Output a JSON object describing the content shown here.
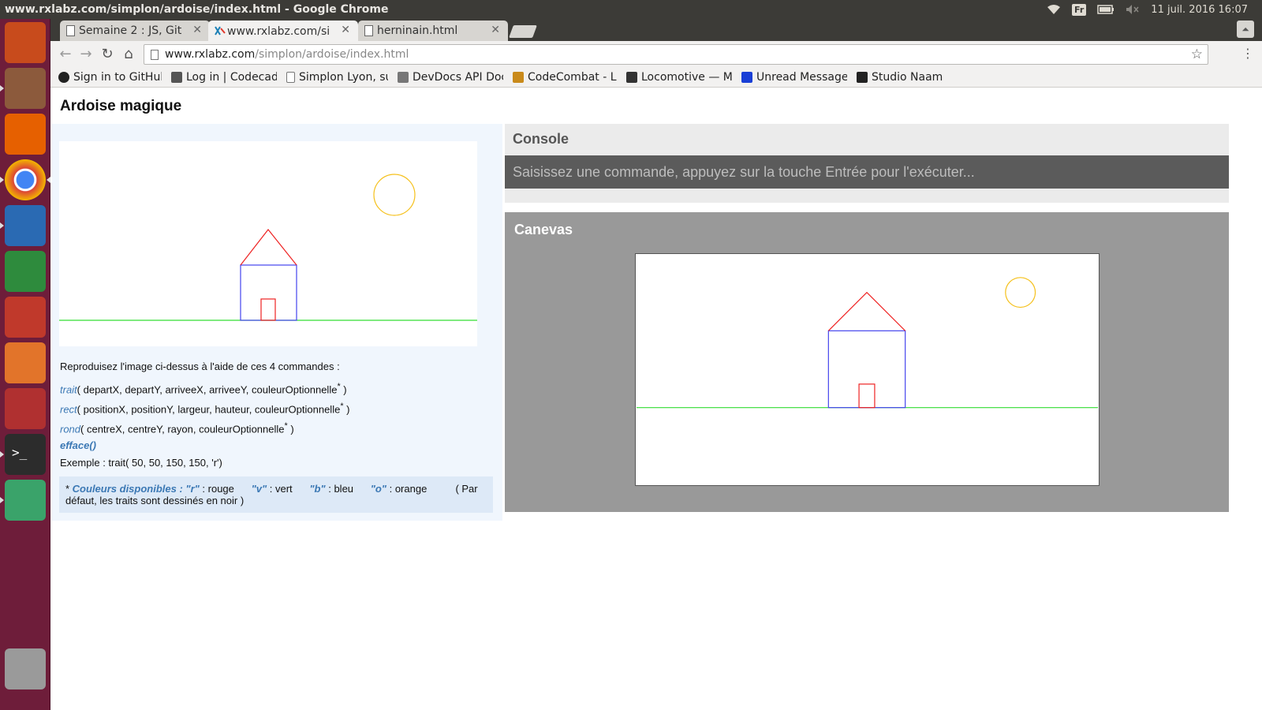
{
  "os": {
    "window_title": "www.rxlabz.com/simplon/ardoise/index.html - Google Chrome",
    "keyboard_layout": "Fr",
    "datetime": "11 juil. 2016 16:07",
    "icons": [
      "wifi-icon",
      "keyboard-icon",
      "battery-icon",
      "volume-muted-icon"
    ]
  },
  "launcher": {
    "apps": [
      {
        "name": "ubuntu-dash",
        "color": "#c84b1c"
      },
      {
        "name": "files",
        "color": "#8c5a3c"
      },
      {
        "name": "firefox",
        "color": "#e66000"
      },
      {
        "name": "chrome",
        "color": "#4285f4"
      },
      {
        "name": "libreoffice-writer",
        "color": "#2a6ab3"
      },
      {
        "name": "libreoffice-calc",
        "color": "#2e8b3d"
      },
      {
        "name": "libreoffice-impress",
        "color": "#c0392b"
      },
      {
        "name": "software-center",
        "color": "#e2742a"
      },
      {
        "name": "system-settings",
        "color": "#b03030"
      },
      {
        "name": "terminal",
        "color": "#2c2c2c"
      },
      {
        "name": "atom",
        "color": "#3aa36a"
      },
      {
        "name": "trash",
        "color": "#9a9a9a"
      }
    ]
  },
  "tabs": [
    {
      "label": "Semaine 2 : JS, Git",
      "active": false
    },
    {
      "label": "www.rxlabz.com/si",
      "active": true
    },
    {
      "label": "herninain.html",
      "active": false
    }
  ],
  "address_bar": {
    "host": "www.rxlabz.com",
    "path": "/simplon/ardoise/index.html"
  },
  "bookmarks": [
    {
      "label": "Sign in to GitHub",
      "icon": "github-icon",
      "color": "#222222"
    },
    {
      "label": "Log in | Codecad",
      "icon": "codecademy-icon",
      "color": "#555555"
    },
    {
      "label": "Simplon Lyon, su",
      "icon": "page-icon",
      "color": "#777777"
    },
    {
      "label": "DevDocs API Doc",
      "icon": "devdocs-icon",
      "color": "#777777"
    },
    {
      "label": "CodeCombat - Le",
      "icon": "codecombat-icon",
      "color": "#c98a1b"
    },
    {
      "label": "Locomotive — M",
      "icon": "locomotive-icon",
      "color": "#333333"
    },
    {
      "label": "Unread Message",
      "icon": "messenger-icon",
      "color": "#1a3fd6"
    },
    {
      "label": "Studio Naam",
      "icon": "studio-naam-icon",
      "color": "#222222"
    }
  ],
  "page": {
    "title": "Ardoise magique",
    "intro": "Reproduisez l'image ci-dessus à l'aide de ces 4 commandes :",
    "commands": [
      {
        "name": "trait",
        "args": "( departX, departY, arriveeX, arriveeY, couleurOptionnelle",
        "close": " )"
      },
      {
        "name": "rect",
        "args": "( positionX, positionY, largeur, hauteur, couleurOptionnelle",
        "close": " )"
      },
      {
        "name": "rond",
        "args": "( centreX, centreY, rayon, couleurOptionnelle",
        "close": " )"
      }
    ],
    "star": "*",
    "efface": "efface()",
    "example": "Exemple : trait( 50, 50, 150, 150, 'r')",
    "colors_note": {
      "prefix": "* ",
      "label": "Couleurs disponibles : ",
      "r_key": "\"r\"",
      "r_val": " : rouge",
      "v_key": "\"v\"",
      "v_val": " : vert",
      "b_key": "\"b\"",
      "b_val": " : bleu",
      "o_key": "\"o\"",
      "o_val": " : orange",
      "default": "( Par défaut, les traits sont dessinés en noir )"
    },
    "console": {
      "title": "Console",
      "placeholder": "Saisissez une commande, appuyez sur la touche Entrée pour l'exécuter..."
    },
    "canvas": {
      "title": "Canevas"
    },
    "colors": {
      "red": "#ee2222",
      "green": "#33dd33",
      "blue": "#4444ee",
      "orange": "#f5c01a"
    }
  }
}
